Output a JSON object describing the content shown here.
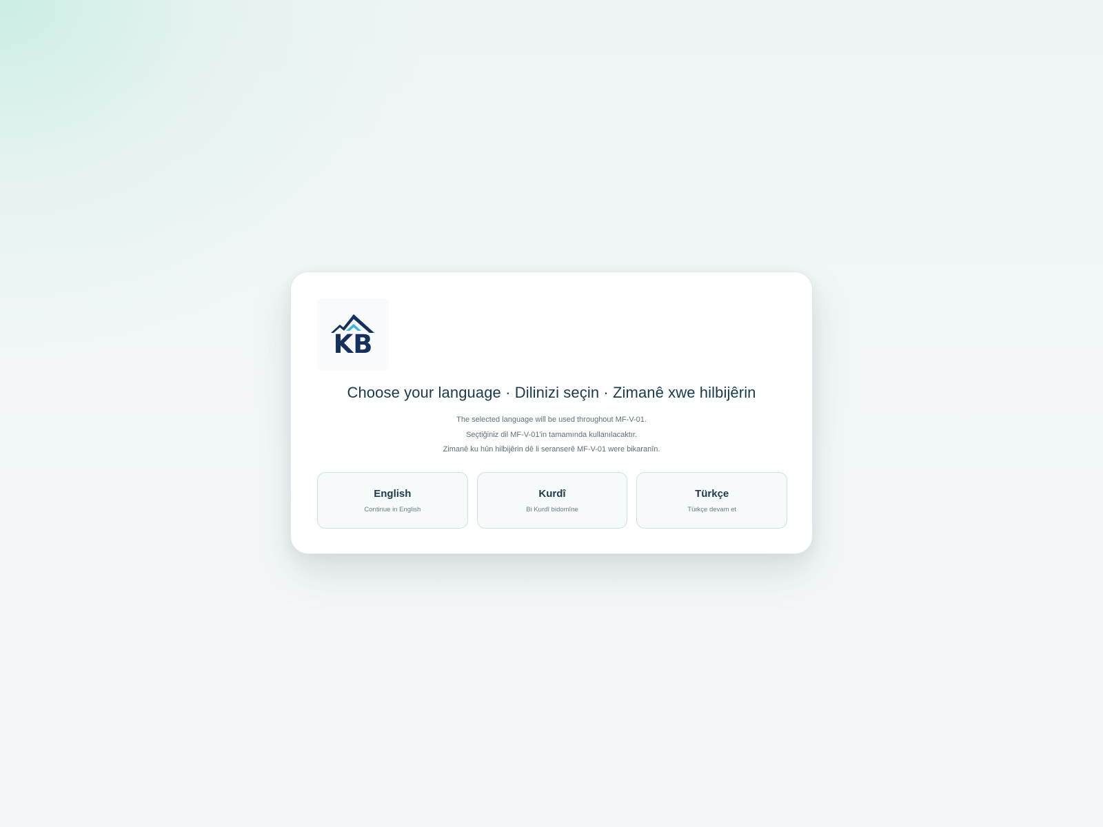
{
  "logo": {
    "text": "KB",
    "icon": "mountain-logo-icon",
    "colors": {
      "navy": "#13315c",
      "teal": "#3fb6cf"
    }
  },
  "title": "Choose your language · Dilinizi seçin · Zimanê xwe hilbijêrin",
  "subtitle": [
    "The selected language will be used throughout MF-V-01.",
    "Seçtiğiniz dil MF-V-01'in tamamında kullanılacaktır.",
    "Zimanê ku hûn hilbijêrin dê li seranserê MF-V-01 were bikaranîn."
  ],
  "options": [
    {
      "label": "English",
      "sub": "Continue in English"
    },
    {
      "label": "Kurdî",
      "sub": "Bi Kurdî bidomîne"
    },
    {
      "label": "Türkçe",
      "sub": "Türkçe devam et"
    }
  ]
}
